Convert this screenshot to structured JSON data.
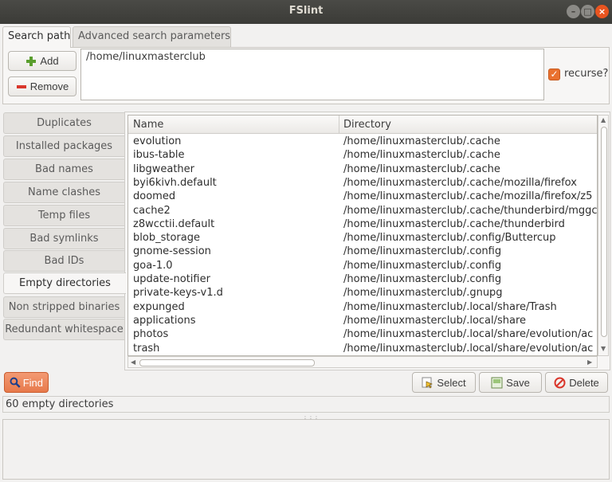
{
  "window": {
    "title": "FSlint"
  },
  "tabs": [
    {
      "label": "Search path"
    },
    {
      "label": "Advanced search parameters"
    }
  ],
  "search_path": {
    "add_label": "Add",
    "remove_label": "Remove",
    "paths": "/home/linuxmasterclub",
    "recurse_label": "recurse?",
    "recurse_checked": true
  },
  "side_tabs": [
    {
      "label": "Duplicates"
    },
    {
      "label": "Installed packages"
    },
    {
      "label": "Bad names"
    },
    {
      "label": "Name clashes"
    },
    {
      "label": "Temp files"
    },
    {
      "label": "Bad symlinks"
    },
    {
      "label": "Bad IDs"
    },
    {
      "label": "Empty directories"
    },
    {
      "label": "Non stripped binaries"
    },
    {
      "label": "Redundant whitespace"
    }
  ],
  "active_side_tab": "Empty directories",
  "table": {
    "columns": [
      "Name",
      "Directory"
    ],
    "rows": [
      [
        "evolution",
        "/home/linuxmasterclub/.cache"
      ],
      [
        "ibus-table",
        "/home/linuxmasterclub/.cache"
      ],
      [
        "libgweather",
        "/home/linuxmasterclub/.cache"
      ],
      [
        "byi6kivh.default",
        "/home/linuxmasterclub/.cache/mozilla/firefox"
      ],
      [
        "doomed",
        "/home/linuxmasterclub/.cache/mozilla/firefox/z5"
      ],
      [
        "cache2",
        "/home/linuxmasterclub/.cache/thunderbird/mggc"
      ],
      [
        "z8wcctii.default",
        "/home/linuxmasterclub/.cache/thunderbird"
      ],
      [
        "blob_storage",
        "/home/linuxmasterclub/.config/Buttercup"
      ],
      [
        "gnome-session",
        "/home/linuxmasterclub/.config"
      ],
      [
        "goa-1.0",
        "/home/linuxmasterclub/.config"
      ],
      [
        "update-notifier",
        "/home/linuxmasterclub/.config"
      ],
      [
        "private-keys-v1.d",
        "/home/linuxmasterclub/.gnupg"
      ],
      [
        "expunged",
        "/home/linuxmasterclub/.local/share/Trash"
      ],
      [
        "applications",
        "/home/linuxmasterclub/.local/share"
      ],
      [
        "photos",
        "/home/linuxmasterclub/.local/share/evolution/ac"
      ],
      [
        "trash",
        "/home/linuxmasterclub/.local/share/evolution/ac"
      ]
    ]
  },
  "actions": {
    "find_label": "Find",
    "select_label": "Select",
    "save_label": "Save",
    "delete_label": "Delete"
  },
  "status": {
    "text": "60 empty directories"
  },
  "colors": {
    "accent": "#e9712f",
    "titlebar": "#3b3b37",
    "close": "#e9541f"
  }
}
